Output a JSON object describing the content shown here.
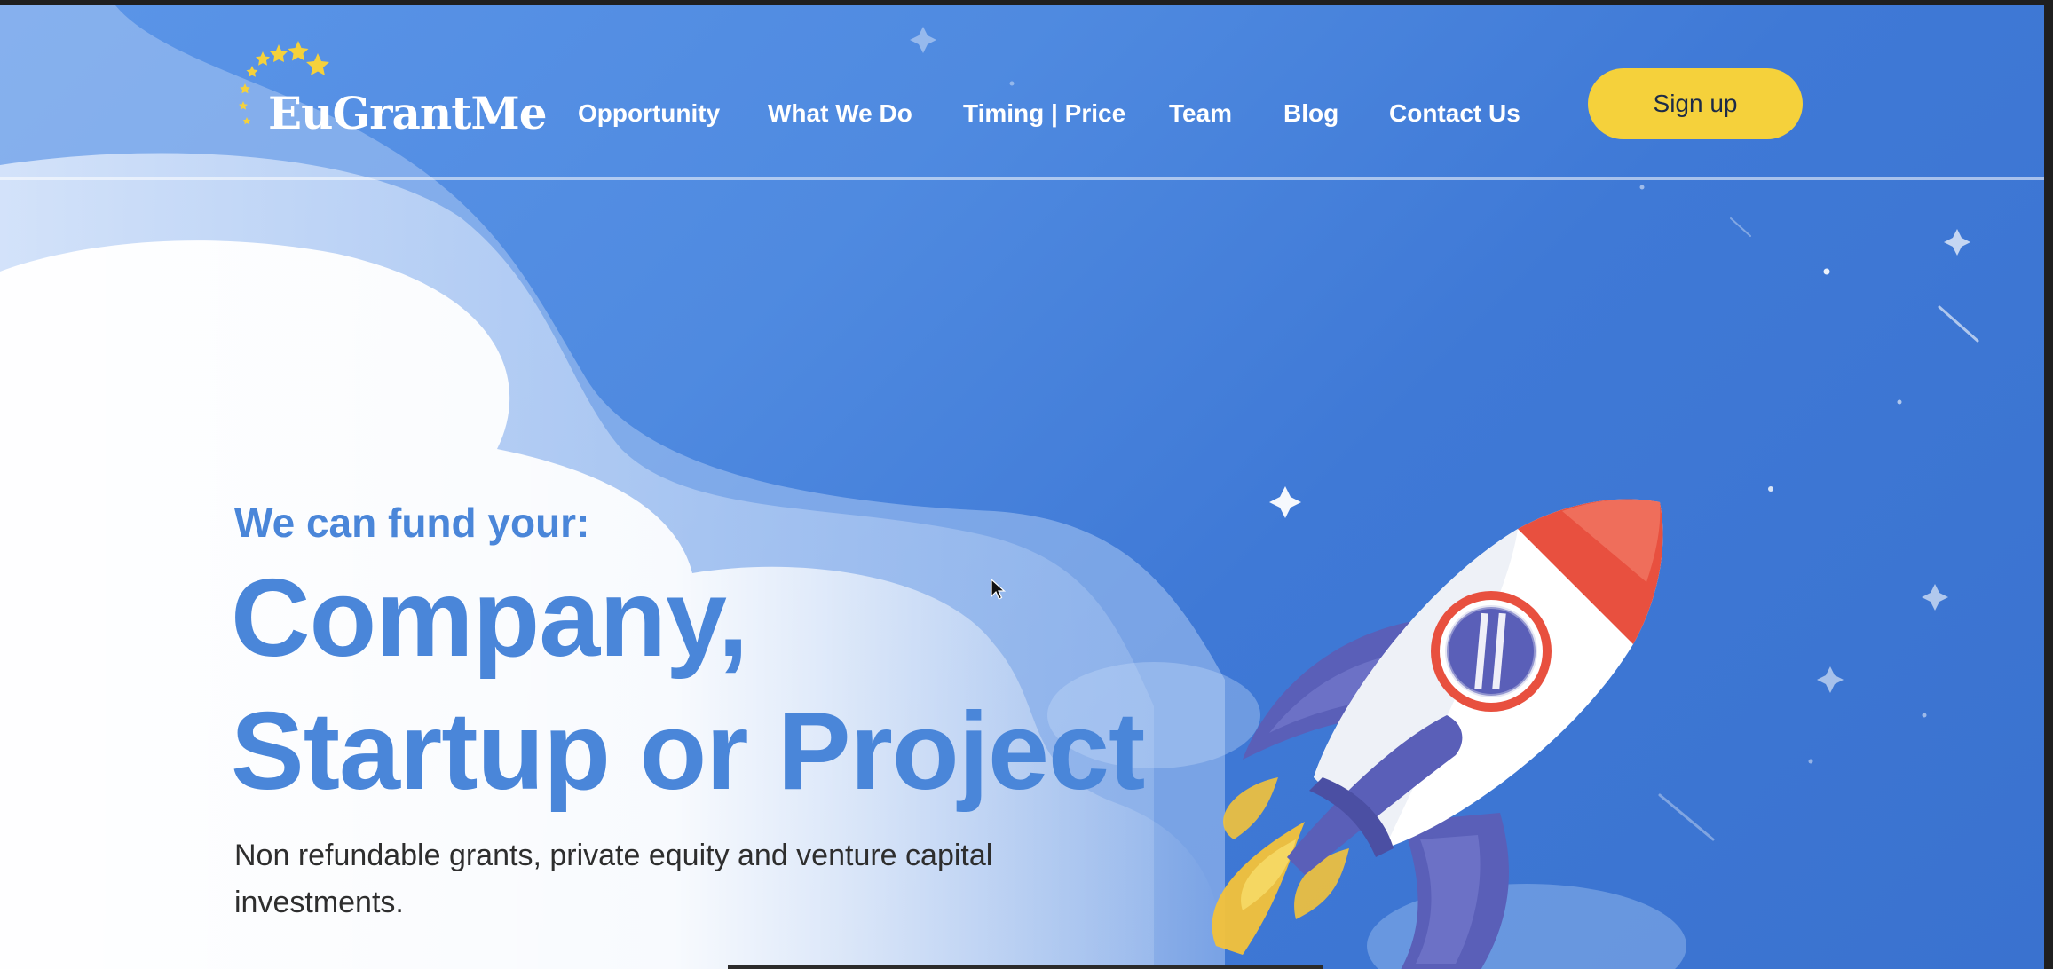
{
  "brand": {
    "name": "EuGrantMe",
    "star_color": "#f5d13b"
  },
  "nav": {
    "items": [
      {
        "label": "Opportunity"
      },
      {
        "label": "What We Do"
      },
      {
        "label": "Timing | Price"
      },
      {
        "label": "Team"
      },
      {
        "label": "Blog"
      },
      {
        "label": "Contact Us"
      }
    ],
    "signup_label": "Sign up"
  },
  "hero": {
    "eyebrow": "We can fund your:",
    "headline_line1": "Company,",
    "headline_line2": "Startup or Project",
    "subtitle": "Non refundable grants, private equity and venture capital investments."
  },
  "colors": {
    "accent_blue": "#4a86d9",
    "signup_yellow": "#f5d13b",
    "rocket_red": "#e8503f",
    "rocket_purple": "#5a5fb8"
  }
}
